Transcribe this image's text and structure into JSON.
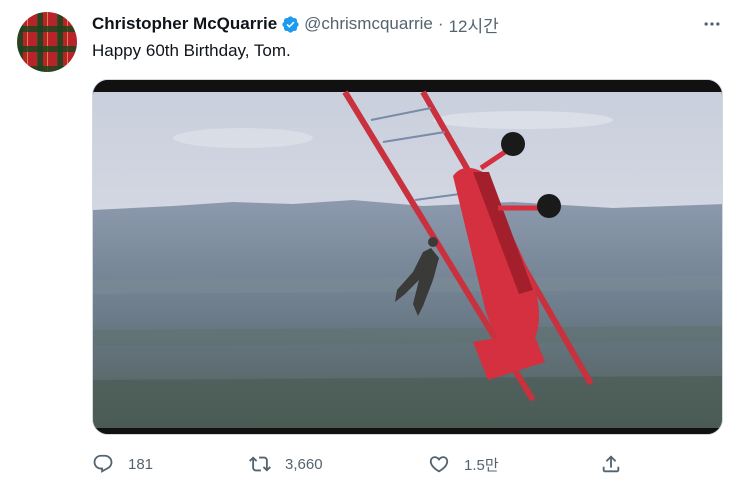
{
  "tweet": {
    "author": {
      "display_name": "Christopher McQuarrie",
      "handle": "@chrismcquarrie",
      "verified": true,
      "avatar_icon": "tartan-avatar-icon"
    },
    "separator": "·",
    "timestamp": "12시간",
    "text": "Happy 60th Birthday, Tom.",
    "media": {
      "description_icon": "biplane-photo",
      "accent_color": "#d4303f"
    },
    "actions": {
      "reply_count": "181",
      "retweet_count": "3,660",
      "like_count": "1.5만",
      "reply_icon": "reply-icon",
      "retweet_icon": "retweet-icon",
      "like_icon": "heart-icon",
      "share_icon": "share-icon"
    }
  },
  "colors": {
    "primary_text": "#0f1419",
    "secondary_text": "#536471",
    "verified_blue": "#1d9bf0"
  }
}
